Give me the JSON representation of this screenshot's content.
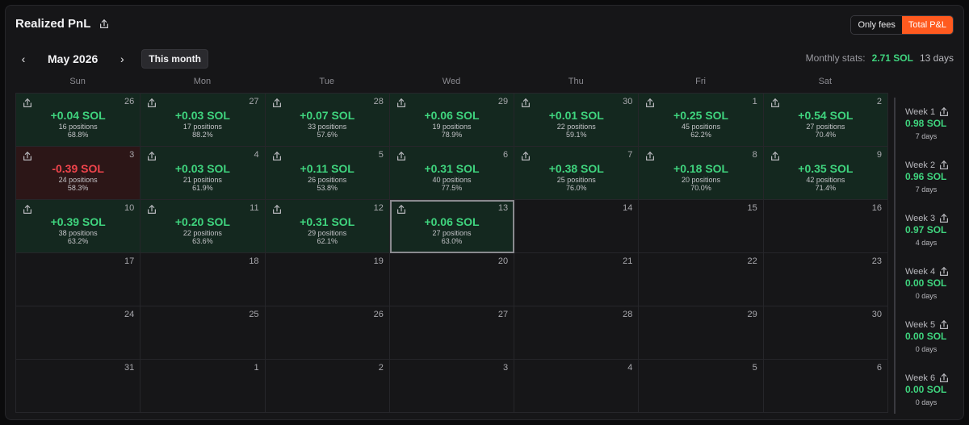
{
  "header": {
    "title": "Realized PnL"
  },
  "toggle": {
    "only_fees": "Only fees",
    "total_pnl": "Total P&L",
    "active": "total_pnl"
  },
  "nav": {
    "month": "May 2026",
    "this_month": "This month",
    "prev_glyph": "‹",
    "next_glyph": "›"
  },
  "stats": {
    "label": "Monthly stats:",
    "value": "2.71 SOL",
    "days": "13 days"
  },
  "weekdays": [
    "Sun",
    "Mon",
    "Tue",
    "Wed",
    "Thu",
    "Fri",
    "Sat"
  ],
  "days": [
    {
      "day": "26",
      "pnl": "+0.04 SOL",
      "positions": "16 positions",
      "rate": "68.8%",
      "state": "pos"
    },
    {
      "day": "27",
      "pnl": "+0.03 SOL",
      "positions": "17 positions",
      "rate": "88.2%",
      "state": "pos"
    },
    {
      "day": "28",
      "pnl": "+0.07 SOL",
      "positions": "33 positions",
      "rate": "57.6%",
      "state": "pos"
    },
    {
      "day": "29",
      "pnl": "+0.06 SOL",
      "positions": "19 positions",
      "rate": "78.9%",
      "state": "pos"
    },
    {
      "day": "30",
      "pnl": "+0.01 SOL",
      "positions": "22 positions",
      "rate": "59.1%",
      "state": "pos"
    },
    {
      "day": "1",
      "pnl": "+0.25 SOL",
      "positions": "45 positions",
      "rate": "62.2%",
      "state": "pos"
    },
    {
      "day": "2",
      "pnl": "+0.54 SOL",
      "positions": "27 positions",
      "rate": "70.4%",
      "state": "pos"
    },
    {
      "day": "3",
      "pnl": "-0.39 SOL",
      "positions": "24 positions",
      "rate": "58.3%",
      "state": "neg"
    },
    {
      "day": "4",
      "pnl": "+0.03 SOL",
      "positions": "21 positions",
      "rate": "61.9%",
      "state": "pos"
    },
    {
      "day": "5",
      "pnl": "+0.11 SOL",
      "positions": "26 positions",
      "rate": "53.8%",
      "state": "pos"
    },
    {
      "day": "6",
      "pnl": "+0.31 SOL",
      "positions": "40 positions",
      "rate": "77.5%",
      "state": "pos"
    },
    {
      "day": "7",
      "pnl": "+0.38 SOL",
      "positions": "25 positions",
      "rate": "76.0%",
      "state": "pos"
    },
    {
      "day": "8",
      "pnl": "+0.18 SOL",
      "positions": "20 positions",
      "rate": "70.0%",
      "state": "pos"
    },
    {
      "day": "9",
      "pnl": "+0.35 SOL",
      "positions": "42 positions",
      "rate": "71.4%",
      "state": "pos"
    },
    {
      "day": "10",
      "pnl": "+0.39 SOL",
      "positions": "38 positions",
      "rate": "63.2%",
      "state": "pos"
    },
    {
      "day": "11",
      "pnl": "+0.20 SOL",
      "positions": "22 positions",
      "rate": "63.6%",
      "state": "pos"
    },
    {
      "day": "12",
      "pnl": "+0.31 SOL",
      "positions": "29 positions",
      "rate": "62.1%",
      "state": "pos"
    },
    {
      "day": "13",
      "pnl": "+0.06 SOL",
      "positions": "27 positions",
      "rate": "63.0%",
      "state": "pos",
      "today": true
    },
    {
      "day": "14",
      "state": "empty"
    },
    {
      "day": "15",
      "state": "empty"
    },
    {
      "day": "16",
      "state": "empty"
    },
    {
      "day": "17",
      "state": "empty"
    },
    {
      "day": "18",
      "state": "empty"
    },
    {
      "day": "19",
      "state": "empty"
    },
    {
      "day": "20",
      "state": "empty"
    },
    {
      "day": "21",
      "state": "empty"
    },
    {
      "day": "22",
      "state": "empty"
    },
    {
      "day": "23",
      "state": "empty"
    },
    {
      "day": "24",
      "state": "empty"
    },
    {
      "day": "25",
      "state": "empty"
    },
    {
      "day": "26",
      "state": "empty"
    },
    {
      "day": "27",
      "state": "empty"
    },
    {
      "day": "28",
      "state": "empty"
    },
    {
      "day": "29",
      "state": "empty"
    },
    {
      "day": "30",
      "state": "empty"
    },
    {
      "day": "31",
      "state": "empty"
    },
    {
      "day": "1",
      "state": "empty"
    },
    {
      "day": "2",
      "state": "empty"
    },
    {
      "day": "3",
      "state": "empty"
    },
    {
      "day": "4",
      "state": "empty"
    },
    {
      "day": "5",
      "state": "empty"
    },
    {
      "day": "6",
      "state": "empty"
    }
  ],
  "weeks": [
    {
      "label": "Week 1",
      "value": "0.98 SOL",
      "days": "7 days"
    },
    {
      "label": "Week 2",
      "value": "0.96 SOL",
      "days": "7 days"
    },
    {
      "label": "Week 3",
      "value": "0.97 SOL",
      "days": "4 days"
    },
    {
      "label": "Week 4",
      "value": "0.00 SOL",
      "days": "0 days"
    },
    {
      "label": "Week 5",
      "value": "0.00 SOL",
      "days": "0 days"
    },
    {
      "label": "Week 6",
      "value": "0.00 SOL",
      "days": "0 days"
    }
  ],
  "colors": {
    "accent": "#ff5a1f",
    "profit": "#3fd47e",
    "loss": "#f0444c",
    "profit_bg": "#14281f",
    "loss_bg": "#2c1617"
  },
  "icons": {
    "share": "share-icon",
    "prev": "chevron-left-icon",
    "next": "chevron-right-icon"
  }
}
